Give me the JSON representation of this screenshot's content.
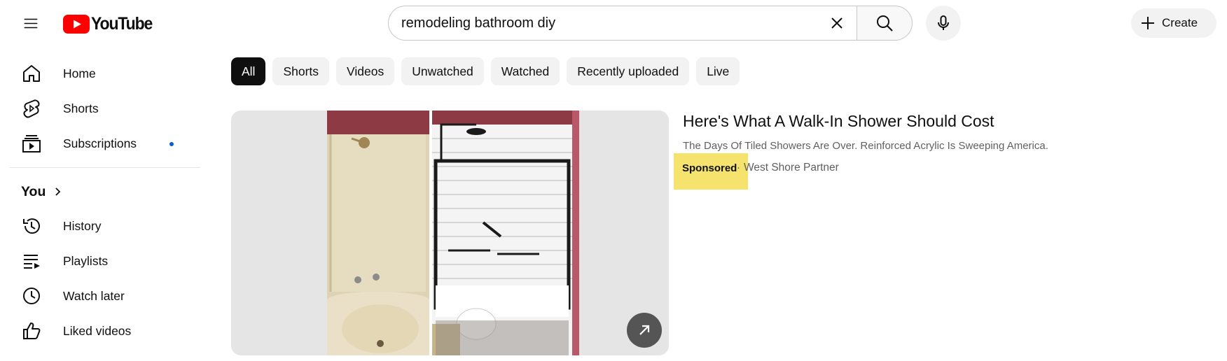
{
  "header": {
    "logo_text": "YouTube",
    "search_value": "remodeling bathroom diy",
    "create_label": "Create",
    "icons": [
      "menu-icon",
      "search-icon",
      "clear-icon",
      "mic-icon",
      "plus-icon"
    ]
  },
  "sidebar": {
    "items": [
      {
        "label": "Home",
        "icon": "home-icon"
      },
      {
        "label": "Shorts",
        "icon": "shorts-icon"
      },
      {
        "label": "Subscriptions",
        "icon": "subscriptions-icon"
      }
    ],
    "you_label": "You",
    "you_items": [
      {
        "label": "History",
        "icon": "history-icon"
      },
      {
        "label": "Playlists",
        "icon": "playlists-icon"
      },
      {
        "label": "Watch later",
        "icon": "clock-icon"
      },
      {
        "label": "Liked videos",
        "icon": "thumbs-up-icon"
      }
    ]
  },
  "chips": [
    "All",
    "Shorts",
    "Videos",
    "Unwatched",
    "Watched",
    "Recently uploaded",
    "Live"
  ],
  "result": {
    "title": "Here's What A Walk-In Shower Should Cost",
    "description": "The Days Of Tiled Showers Are Over. Reinforced Acrylic Is Sweeping America.",
    "sponsored": "Sponsored",
    "separator": "·",
    "advertiser": "West Shore Partner"
  },
  "colors": {
    "brand_red": "#ff0000",
    "chip_active": "#0f0f0f",
    "chip_bg": "#f2f2f2",
    "notification_dot": "#065fd4",
    "highlight": "#f5e36e"
  }
}
